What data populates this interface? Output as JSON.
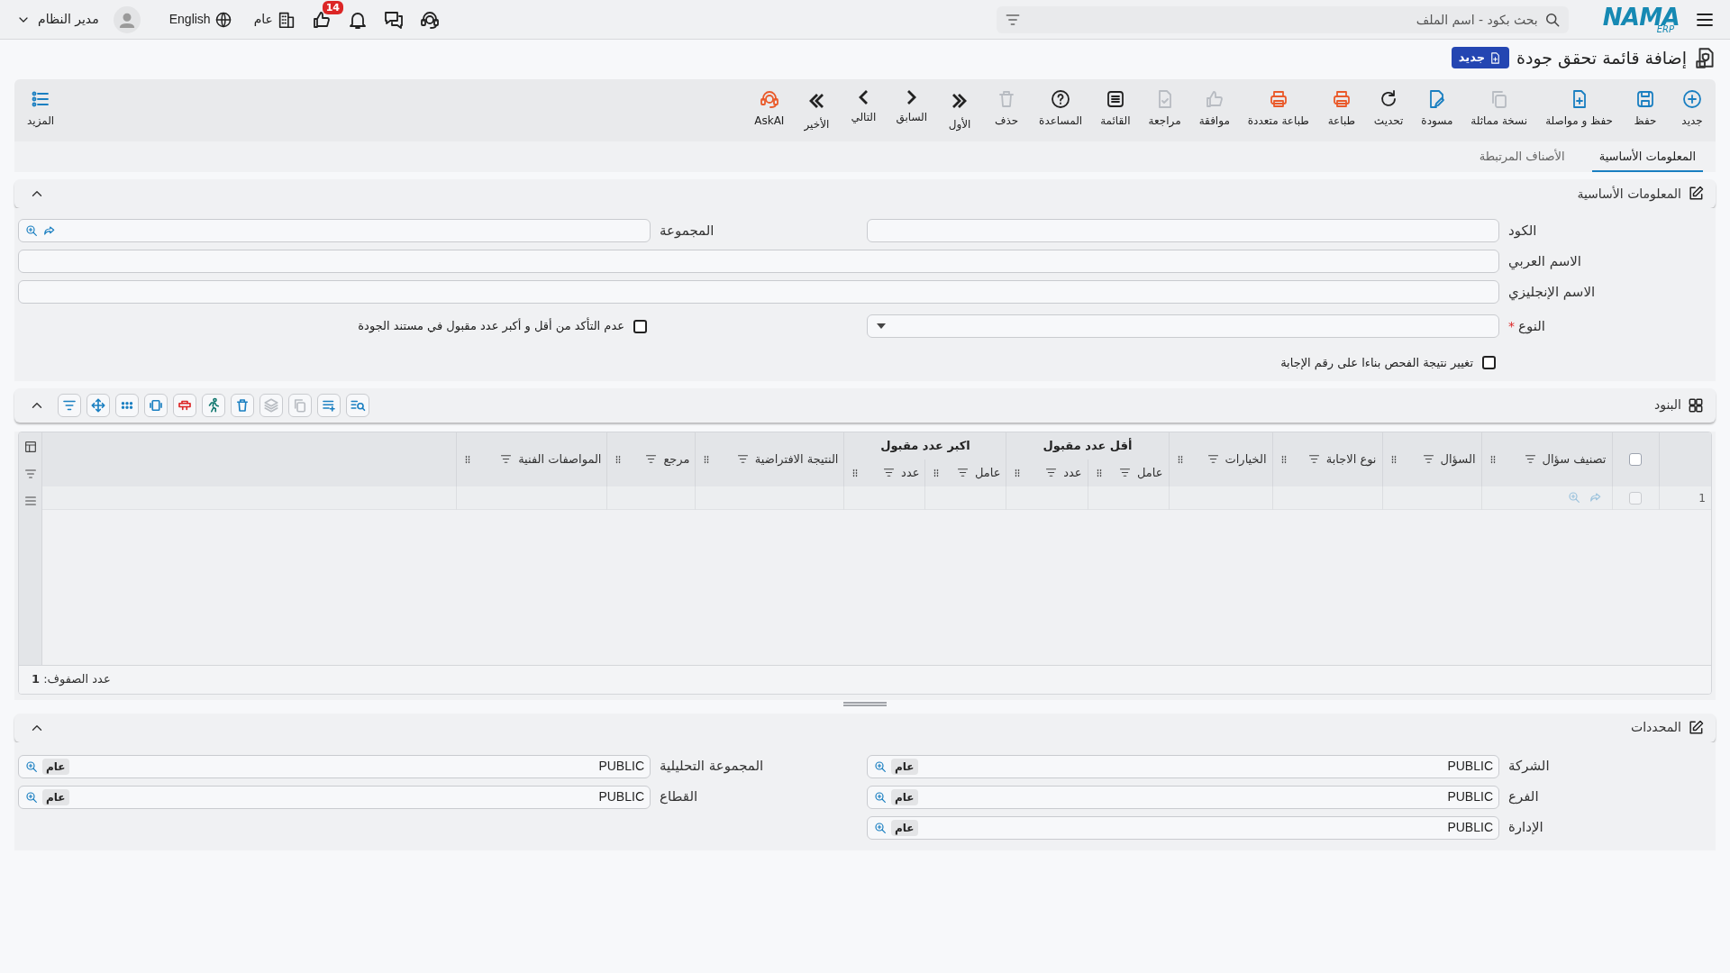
{
  "topbar": {
    "logo": "NAMA",
    "logo_sub": "ERP",
    "search_placeholder": "بحث بكود - اسم الملف",
    "notification_count": "14",
    "organization": "عام",
    "language": "English",
    "user": "مدير النظام"
  },
  "page": {
    "title": "إضافة قائمة تحقق جودة",
    "badge": "جديد"
  },
  "toolbar": [
    {
      "label": "جديد",
      "color": "#1a7fc1"
    },
    {
      "label": "حفظ",
      "color": "#1a7fc1"
    },
    {
      "label": "حفظ و مواصلة",
      "color": "#1a7fc1"
    },
    {
      "label": "نسخة مماثلة",
      "color": "#b8bcc2"
    },
    {
      "label": "مسودة",
      "color": "#1a7fc1"
    },
    {
      "label": "تحديث",
      "color": "#222222"
    },
    {
      "label": "طباعة",
      "color": "#ea5a2a"
    },
    {
      "label": "طباعة متعددة",
      "color": "#ea5a2a"
    },
    {
      "label": "موافقة",
      "color": "#b8bcc2"
    },
    {
      "label": "مراجعة",
      "color": "#b8bcc2"
    },
    {
      "label": "القائمة",
      "color": "#222222"
    },
    {
      "label": "المساعدة",
      "color": "#222222"
    },
    {
      "label": "حذف",
      "color": "#b8bcc2"
    },
    {
      "label": "الأول",
      "color": "#222222"
    },
    {
      "label": "السابق",
      "color": "#222222"
    },
    {
      "label": "التالي",
      "color": "#222222"
    },
    {
      "label": "الأخير",
      "color": "#222222"
    },
    {
      "label": "AskAI",
      "color": "#ea5a2a"
    }
  ],
  "more_button": "المزيد",
  "tabs": [
    {
      "label": "المعلومات الأساسية",
      "selected": true
    },
    {
      "label": "الأصناف المرتبطة",
      "selected": false
    }
  ],
  "basic_info": {
    "title": "المعلومات الأساسية",
    "code_label": "الكود",
    "group_label": "المجموعة",
    "arabic_name_label": "الاسم العربي",
    "english_name_label": "الاسم الإنجليزي",
    "type_label": "النوع",
    "required_mark": "*",
    "skip_check": {
      "label": "عدم التأكد من أقل و أكبر عدد مقبول في مستند الجودة",
      "checked": false
    },
    "change_result": {
      "label": "تغيير نتيجة الفحص بناءا على رقم الإجابة",
      "checked": false
    }
  },
  "items": {
    "title": "البنود",
    "tools": [
      {
        "color": "#1a7fc1"
      },
      {
        "color": "#1a7fc1"
      },
      {
        "color": "#b8bcc2"
      },
      {
        "color": "#b8bcc2"
      },
      {
        "color": "#1a7fc1"
      },
      {
        "color": "#0f766e"
      },
      {
        "color": "#dc2626"
      },
      {
        "color": "#1a7fc1"
      },
      {
        "color": "#1a7fc1"
      },
      {
        "color": "#1a7fc1"
      },
      {
        "color": "#1a7fc1"
      }
    ],
    "columns": [
      {
        "label": "تصنيف سؤال"
      },
      {
        "label": "السؤال"
      },
      {
        "label": "نوع الاجابة"
      },
      {
        "label": "الخيارات"
      },
      {
        "label": "أقل عدد مقبول",
        "children": [
          {
            "label": "عامل"
          },
          {
            "label": "عدد"
          }
        ]
      },
      {
        "label": "اكبر عدد مقبول",
        "children": [
          {
            "label": "عامل"
          },
          {
            "label": "عدد"
          }
        ]
      },
      {
        "label": "النتيجة الافتراضية"
      },
      {
        "label": "مرجع"
      },
      {
        "label": "المواصفات الفنية"
      }
    ],
    "all_selected": false,
    "rows": [
      {
        "number": "1",
        "selected": false
      }
    ],
    "row_count": "عدد الصفوف: **1**"
  },
  "determinants": {
    "title": "المحددات",
    "fields": [
      {
        "label": "الشركة",
        "value": "PUBLIC",
        "tag": "عام"
      },
      {
        "label": "المجموعة التحليلية",
        "value": "PUBLIC",
        "tag": "عام"
      },
      {
        "label": "الفرع",
        "value": "PUBLIC",
        "tag": "عام"
      },
      {
        "label": "القطاع",
        "value": "PUBLIC",
        "tag": "عام"
      },
      {
        "label": "الإدارة",
        "value": "PUBLIC",
        "tag": "عام"
      }
    ]
  }
}
